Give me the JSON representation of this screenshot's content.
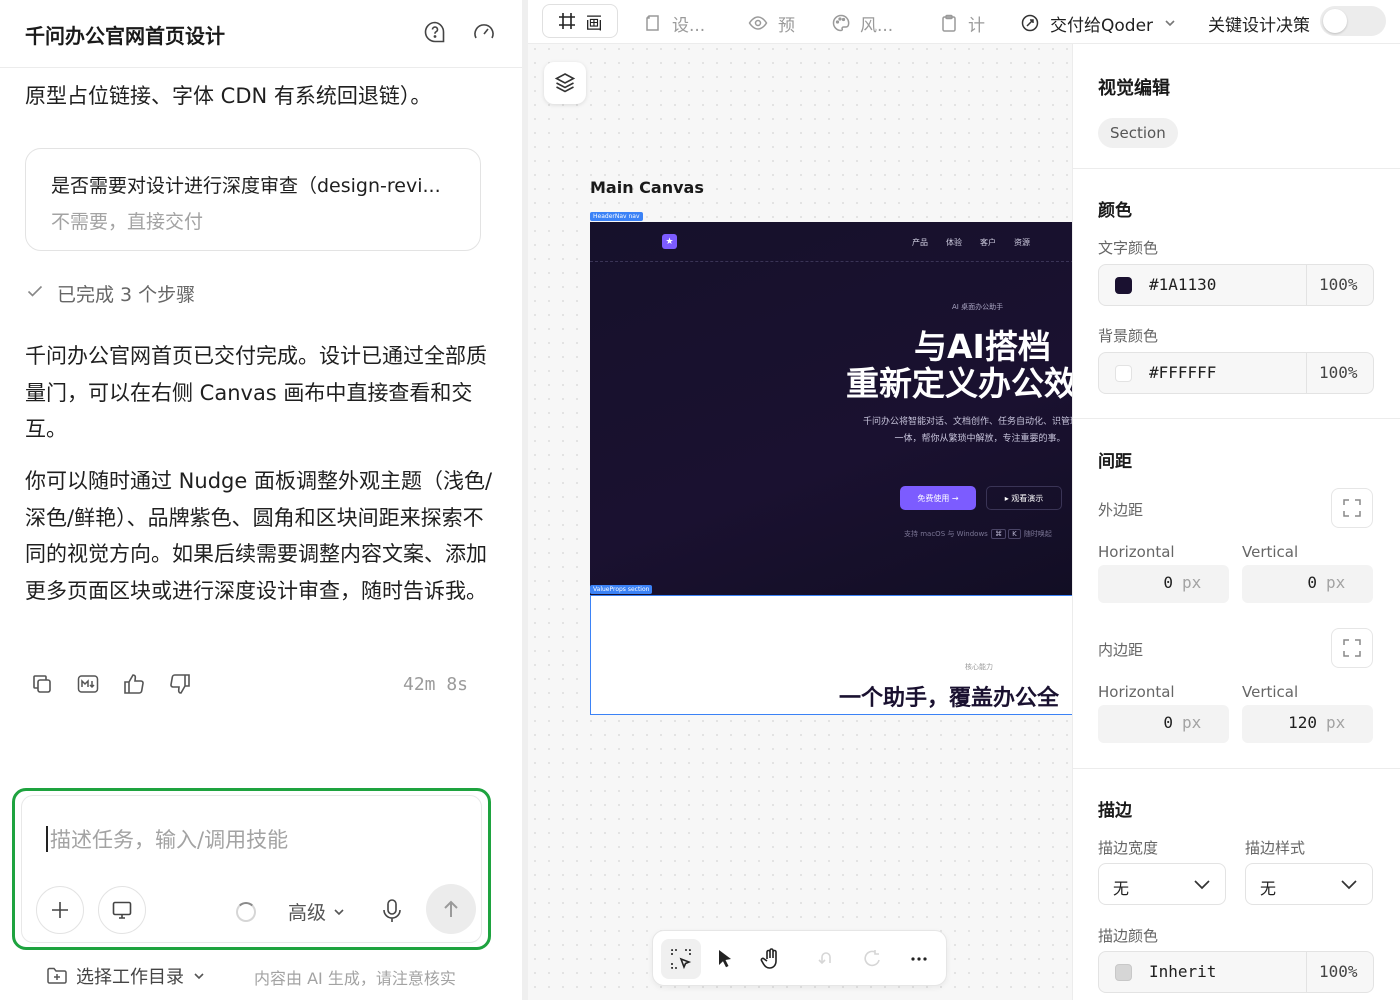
{
  "chat": {
    "title": "千问办公官网首页设计",
    "message_top": "原型占位链接、字体 CDN 有系统回退链）。",
    "question": {
      "title": "是否需要对设计进行深度审查（design-revi...",
      "answer": "不需要，直接交付"
    },
    "steps_done": "已完成 3 个步骤",
    "paragraphs": [
      "千问办公官网首页已交付完成。设计已通过全部质量门，可以在右侧 Canvas 画布中直接查看和交互。",
      "你可以随时通过 Nudge 面板调整外观主题（浅色/深色/鲜艳）、品牌紫色、圆角和区块间距来探索不同的视觉方向。如果后续需要调整内容文案、添加更多页面区块或进行深度设计审查，随时告诉我。"
    ],
    "duration": "42m 8s",
    "input_placeholder": "描述任务，输入/调用技能",
    "advanced_label": "高级",
    "workspace_label": "选择工作目录",
    "ai_note": "内容由 AI 生成，请注意核实"
  },
  "toolbar": {
    "tabs": [
      {
        "label": "画",
        "icon": "frame-icon"
      },
      {
        "label": "设...",
        "icon": "page-icon"
      },
      {
        "label": "预",
        "icon": "eye-icon"
      },
      {
        "label": "风...",
        "icon": "palette-icon"
      },
      {
        "label": "计",
        "icon": "clipboard-icon"
      }
    ],
    "handoff_label": "交付给Qoder",
    "decisions_label": "关键设计决策",
    "decisions_toggle": false
  },
  "canvas": {
    "label": "Main Canvas",
    "header_tag": "HeaderNav nav",
    "section_tag": "ValueProps section",
    "hero": {
      "nav_links": [
        "产品",
        "体验",
        "客户",
        "资源"
      ],
      "eyebrow": "AI 桌面办公助手",
      "headline_1": "与AI搭档",
      "headline_2": "重新定义办公效",
      "description": "千问办公将智能对话、文档创作、任务自动化、识管理融为一体，帮你从繁琐中解放，专注重要的事。",
      "cta_primary": "免费使用 →",
      "cta_secondary": "▸ 观看演示",
      "support_text": "支持 macOS 与 Windows",
      "key_1": "⌘",
      "key_2": "K",
      "shortcut_hint": "随时唤起"
    },
    "section": {
      "eyebrow": "核心能力",
      "title": "一个助手，覆盖办公全"
    }
  },
  "inspector": {
    "title": "视觉编辑",
    "element_type": "Section",
    "colors": {
      "heading": "颜色",
      "text_label": "文字颜色",
      "text_hex": "#1A1130",
      "text_opacity": "100%",
      "bg_label": "背景颜色",
      "bg_hex": "#FFFFFF",
      "bg_opacity": "100%"
    },
    "spacing": {
      "heading": "间距",
      "margin_label": "外边距",
      "padding_label": "内边距",
      "horizontal_label": "Horizontal",
      "vertical_label": "Vertical",
      "unit": "px",
      "margin_h": "0",
      "margin_v": "0",
      "padding_h": "0",
      "padding_v": "120"
    },
    "stroke": {
      "heading": "描边",
      "width_label": "描边宽度",
      "style_label": "描边样式",
      "width_value": "无",
      "style_value": "无",
      "color_label": "描边颜色",
      "color_value": "Inherit",
      "color_opacity": "100%"
    }
  }
}
